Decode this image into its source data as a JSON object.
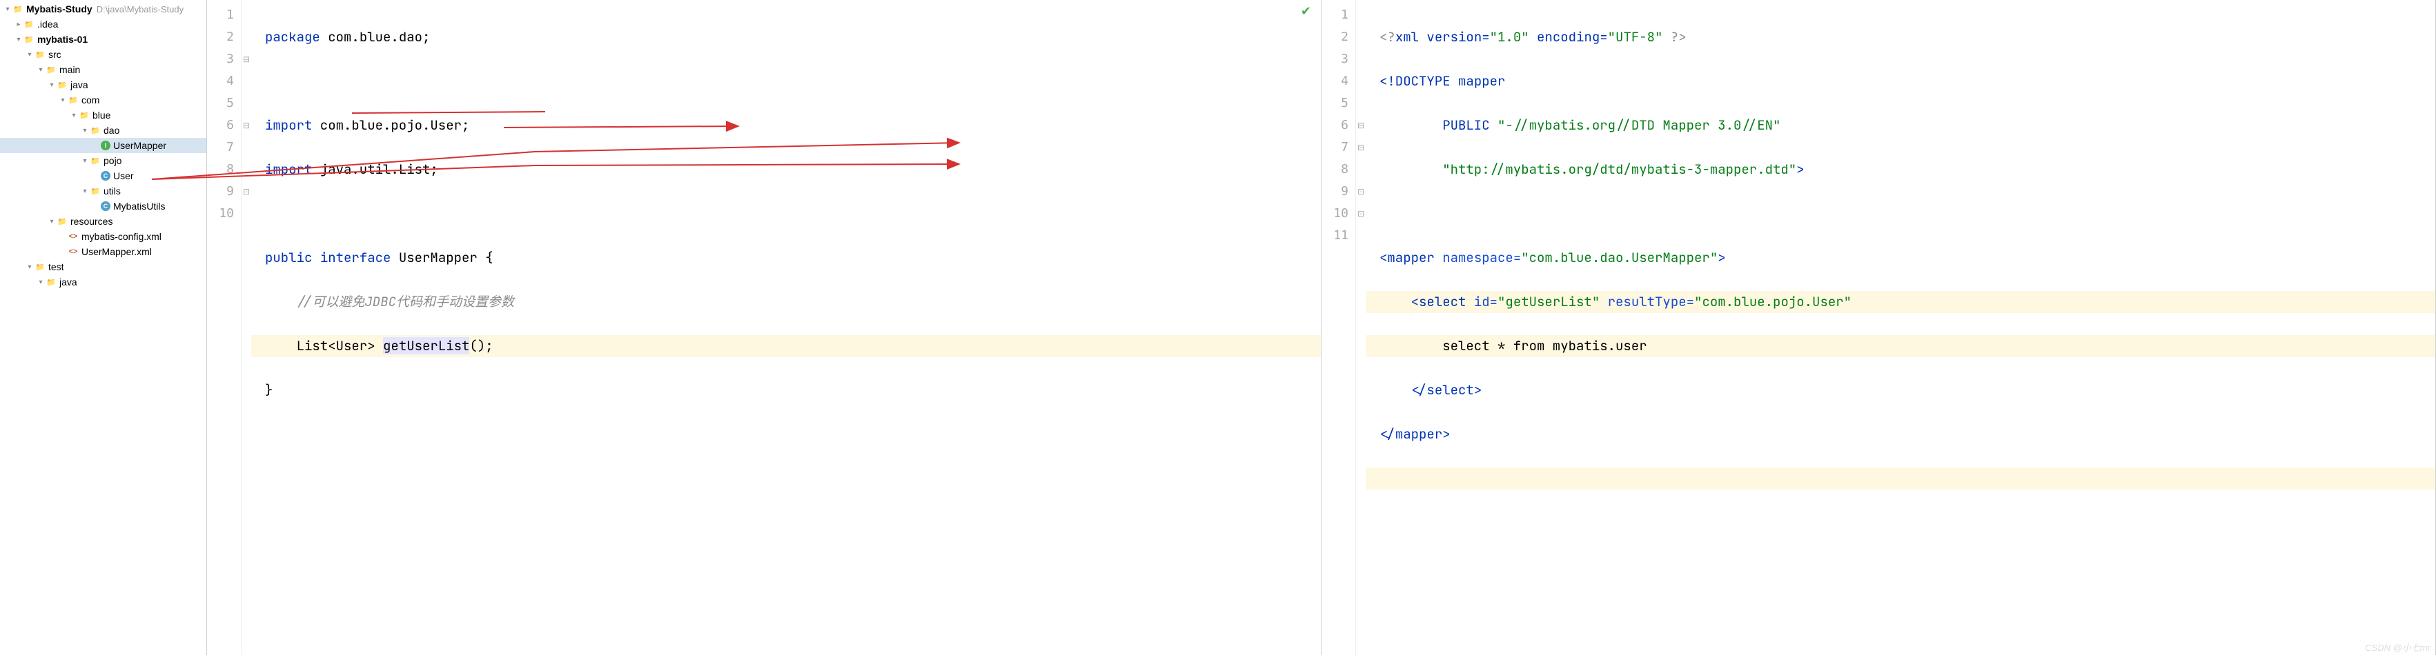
{
  "tree": {
    "root": {
      "label": "Mybatis-Study",
      "path": "D:\\java\\Mybatis-Study"
    },
    "items": [
      {
        "indent": 1,
        "arrow": "right",
        "icon": "folder",
        "label": ".idea"
      },
      {
        "indent": 1,
        "arrow": "down",
        "icon": "folder-src",
        "label": "mybatis-01",
        "bold": true
      },
      {
        "indent": 2,
        "arrow": "down",
        "icon": "folder",
        "label": "src"
      },
      {
        "indent": 3,
        "arrow": "down",
        "icon": "folder",
        "label": "main"
      },
      {
        "indent": 4,
        "arrow": "down",
        "icon": "folder-src",
        "label": "java"
      },
      {
        "indent": 5,
        "arrow": "down",
        "icon": "folder",
        "label": "com"
      },
      {
        "indent": 6,
        "arrow": "down",
        "icon": "folder",
        "label": "blue"
      },
      {
        "indent": 7,
        "arrow": "down",
        "icon": "folder",
        "label": "dao"
      },
      {
        "indent": 8,
        "arrow": "",
        "icon": "file-i",
        "label": "UserMapper",
        "selected": true
      },
      {
        "indent": 7,
        "arrow": "down",
        "icon": "folder",
        "label": "pojo"
      },
      {
        "indent": 8,
        "arrow": "",
        "icon": "file-c",
        "label": "User"
      },
      {
        "indent": 7,
        "arrow": "down",
        "icon": "folder",
        "label": "utils"
      },
      {
        "indent": 8,
        "arrow": "",
        "icon": "file-c",
        "label": "MybatisUtils"
      },
      {
        "indent": 4,
        "arrow": "down",
        "icon": "folder-orange",
        "label": "resources"
      },
      {
        "indent": 5,
        "arrow": "",
        "icon": "file-xml",
        "label": "mybatis-config.xml"
      },
      {
        "indent": 5,
        "arrow": "",
        "icon": "file-xml",
        "label": "UserMapper.xml"
      },
      {
        "indent": 2,
        "arrow": "down",
        "icon": "folder",
        "label": "test"
      },
      {
        "indent": 3,
        "arrow": "down",
        "icon": "folder-green",
        "label": "java"
      }
    ]
  },
  "editor_left": {
    "lines": [
      "1",
      "2",
      "3",
      "4",
      "5",
      "6",
      "7",
      "8",
      "9",
      "10"
    ],
    "code": {
      "l1_kw": "package",
      "l1_rest": " com.blue.dao;",
      "l3_kw": "import",
      "l3_rest": " com.blue.pojo.User;",
      "l4_kw": "import",
      "l4_rest": " java.util.List;",
      "l6_kw1": "public",
      "l6_kw2": "interface",
      "l6_name": " UserMapper ",
      "l6_brace": "{",
      "l7_comment": "//可以避免JDBC代码和手动设置参数",
      "l8_pre": "    List<User> ",
      "l8_method": "getUserList",
      "l8_post": "();",
      "l9_brace": "}"
    }
  },
  "editor_right": {
    "lines": [
      "1",
      "2",
      "3",
      "4",
      "5",
      "6",
      "7",
      "8",
      "9",
      "10",
      "11"
    ],
    "code": {
      "l1_decl": "<?",
      "l1_xml": "xml version=",
      "l1_v": "\"1.0\"",
      "l1_enc": " encoding=",
      "l1_encv": "\"UTF-8\"",
      "l1_end": " ?>",
      "l2_dt": "<!DOCTYPE ",
      "l2_mapper": "mapper",
      "l3_pub": "        PUBLIC ",
      "l3_v": "\"-//mybatis.org//DTD Mapper 3.0//EN\"",
      "l4_pad": "        ",
      "l4_v": "\"http://mybatis.org/dtd/mybatis-3-mapper.dtd\"",
      "l4_close": ">",
      "l6_open": "<",
      "l6_tag": "mapper",
      "l6_attr": " namespace=",
      "l6_val": "\"com.blue.dao.UserMapper\"",
      "l6_close": ">",
      "l7_pad": "    ",
      "l7_open": "<",
      "l7_tag": "select",
      "l7_a1": " id=",
      "l7_v1": "\"getUserList\"",
      "l7_a2": " resultType=",
      "l7_v2": "\"com.blue.pojo.User\"",
      "l8_txt": "        select * from mybatis.user",
      "l9_pad": "    ",
      "l9_open": "</",
      "l9_tag": "select",
      "l9_close": ">",
      "l10_open": "</",
      "l10_tag": "mapper",
      "l10_close": ">"
    }
  },
  "watermark": "CSDN @小七mr"
}
